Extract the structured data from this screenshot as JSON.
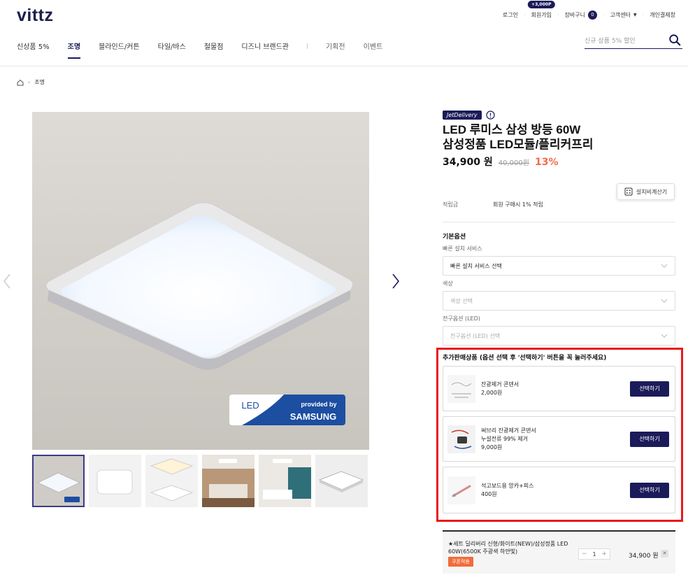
{
  "header": {
    "logo": "vittz",
    "util": {
      "login": "로그인",
      "signup": "회원가입",
      "signup_badge": "+3,000P",
      "cart": "장바구니",
      "cart_count": "0",
      "customer_center": "고객센터",
      "personal_order": "개인결제창"
    },
    "nav": [
      "신상품 5%",
      "조명",
      "블라인드/커튼",
      "타일/바스",
      "철물점",
      "디즈니 브랜드관"
    ],
    "nav_sub": [
      "기획전",
      "이벤트"
    ],
    "search_placeholder": "신규 상품 5% 할인"
  },
  "breadcrumb": {
    "current": "조명"
  },
  "gallery": {
    "led_logo_text": "LED",
    "provided_by": "provided by",
    "brand": "SAMSUNG"
  },
  "product": {
    "badge": "JetDelivery",
    "title_line1": "LED 루미스 삼성 방등 60W",
    "title_line2": "삼성정품 LED모듈/플리커프리",
    "price": "34,900 원",
    "original_price": "40,000원",
    "discount": "13%",
    "calc_button": "설치비계산기",
    "points_label": "적립금",
    "points_value": "회원 구매시 1% 적립"
  },
  "options": {
    "title": "기본옵션",
    "groups": [
      {
        "label": "빠른 설치 서비스",
        "value": "빠른 설치 서비스 선택"
      },
      {
        "label": "색상",
        "value": "색상 선택"
      },
      {
        "label": "전구옵션 (LED)",
        "value": "전구옵션 (LED) 선택"
      }
    ]
  },
  "addons": {
    "title": "추가판매상품 (옵션 선택 후 '선택하기' 버튼을 꼭 눌러주세요)",
    "items": [
      {
        "name": "잔광제거 콘덴서",
        "desc": "",
        "price": "2,000원",
        "button": "선택하기"
      },
      {
        "name": "써브리 잔광제거 콘덴서",
        "desc": "누설전류 99% 제거",
        "price": "9,000원",
        "button": "선택하기"
      },
      {
        "name": "석고보드용 앙카+피스",
        "desc": "",
        "price": "400원",
        "button": "선택하기"
      }
    ]
  },
  "selected": {
    "name": "★세트 딜리버리 신형/화이트(NEW)/삼성정품 LED 60W(6500K 주광색 하얀빛)",
    "coupon": "쿠폰적용",
    "qty": "1",
    "minus": "−",
    "plus": "+",
    "price": "34,900 원",
    "close": "✕"
  },
  "colors": {
    "brand_navy": "#1b1b5a",
    "discount": "#f26b4a",
    "highlight_box": "#e8191a"
  }
}
